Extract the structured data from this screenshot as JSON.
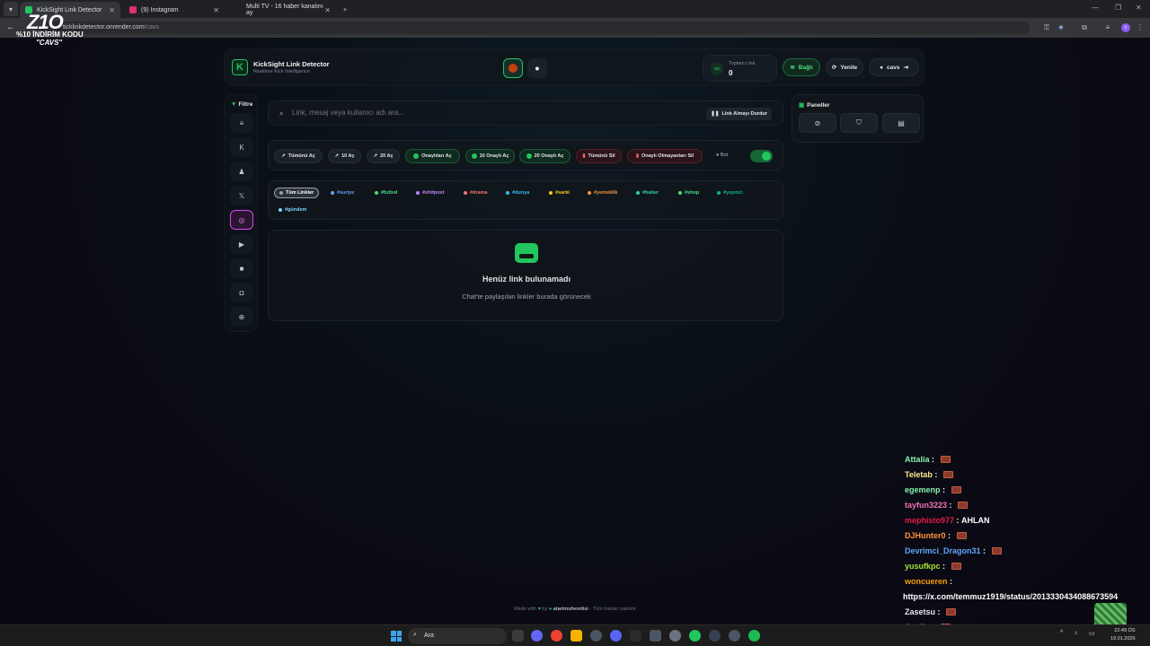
{
  "browser": {
    "tabs": [
      {
        "title": "KickSight Link Detector",
        "active": true
      },
      {
        "title": "(9) Instagram",
        "active": false
      },
      {
        "title": "Multi TV - 16 haber kanalını ay",
        "active": false
      }
    ],
    "url_host": "ticklinkdetector.onrender.com",
    "url_path": "/cavs"
  },
  "overlay_logo": {
    "big": "Z1O",
    "line1": "%10 İNDİRİM KODU",
    "line2": "\"CAVS\""
  },
  "header": {
    "title": "KickSight Link Detector",
    "subtitle": "Realtime Kick Intelligence",
    "stat_label": "Toplam Link",
    "stat_value": "0",
    "connected_label": "Bağlı",
    "refresh_label": "Yenile",
    "user_label": "cavs"
  },
  "sidebar": {
    "filter_label": "Filtre",
    "items": [
      {
        "name": "all",
        "icon": "≡"
      },
      {
        "name": "kick",
        "icon": "K"
      },
      {
        "name": "user",
        "icon": "♟"
      },
      {
        "name": "x",
        "icon": "𝕏"
      },
      {
        "name": "instagram",
        "icon": "◎"
      },
      {
        "name": "youtube",
        "icon": "▶"
      },
      {
        "name": "video",
        "icon": "■"
      },
      {
        "name": "camera",
        "icon": "◘"
      },
      {
        "name": "web",
        "icon": "⊕"
      }
    ]
  },
  "search": {
    "placeholder": "Link, mesaj veya kullanıcı adı ara...",
    "stop_label": "Link Almayı Durdur"
  },
  "actions": [
    {
      "label": "Tümünü Aç",
      "kind": "plain",
      "icon": "↗"
    },
    {
      "label": "10 Aç",
      "kind": "plain",
      "icon": "↗"
    },
    {
      "label": "20 Aç",
      "kind": "plain",
      "icon": "↗"
    },
    {
      "label": "Onaylıları Aç",
      "kind": "green",
      "icon": "dot"
    },
    {
      "label": "10 Onaylı Aç",
      "kind": "green",
      "icon": "dot"
    },
    {
      "label": "20 Onaylı Aç",
      "kind": "green",
      "icon": "dot"
    },
    {
      "label": "Tümünü Sil",
      "kind": "red",
      "icon": "del"
    },
    {
      "label": "Onaylı Olmayanları Sil",
      "kind": "red",
      "icon": "del"
    }
  ],
  "bot_label": "Bot",
  "bot_enabled": true,
  "tags": [
    {
      "label": "Tüm Linkler",
      "color": "#9ca3af",
      "selected": true
    },
    {
      "label": "#suriye",
      "color": "#60a5fa"
    },
    {
      "label": "#futbol",
      "color": "#4ade80"
    },
    {
      "label": "#shitpost",
      "color": "#c084fc"
    },
    {
      "label": "#drama",
      "color": "#f87171"
    },
    {
      "label": "#dunya",
      "color": "#38bdf8"
    },
    {
      "label": "#sarki",
      "color": "#facc15"
    },
    {
      "label": "#yemeklik",
      "color": "#fb923c"
    },
    {
      "label": "#haber",
      "color": "#34d399"
    },
    {
      "label": "#shop",
      "color": "#4ade80"
    },
    {
      "label": "#yayıncı",
      "color": "#10b981"
    },
    {
      "label": "#gündem",
      "color": "#7dd3fc"
    }
  ],
  "empty": {
    "title": "Henüz link bulunamadı",
    "subtitle": "Chat'te paylaşılan linkler burada görünecek"
  },
  "panels": {
    "title": "Paneller",
    "buttons": [
      {
        "icon": "⊘"
      },
      {
        "icon": "⛉"
      },
      {
        "icon": "▤"
      }
    ]
  },
  "footer": {
    "made_with": "Made with",
    "by": "by",
    "author": "atarimuhendisi",
    "rights": "· Tüm hakları saklıdır"
  },
  "chat": [
    {
      "user": "Attalia",
      "color": "#86efac",
      "text": "",
      "emote": true
    },
    {
      "user": "Teletab",
      "color": "#fde68a",
      "text": "",
      "emote": true
    },
    {
      "user": "egemenp",
      "color": "#86efac",
      "text": "",
      "emote": true
    },
    {
      "user": "tayfun3223",
      "color": "#f472b6",
      "text": "",
      "emote": true
    },
    {
      "user": "mephisto977",
      "color": "#e11d48",
      "text": "AHLAN",
      "emote": false
    },
    {
      "user": "DJHunter0",
      "color": "#fb923c",
      "text": "",
      "emote": true
    },
    {
      "user": "Devrimci_Dragon31",
      "color": "#60a5fa",
      "text": "",
      "emote": true
    },
    {
      "user": "yusufkpc",
      "color": "#a3e635",
      "text": "",
      "emote": true
    },
    {
      "user": "woncueren",
      "color": "#f59e0b",
      "text": "",
      "emote": false
    },
    {
      "user": "",
      "color": "#ffffff",
      "text": "https://x.com/temmuz1919/status/2013330434088673594",
      "emote": false
    },
    {
      "user": "Zasetsu",
      "color": "#e5e7eb",
      "text": "",
      "emote": true
    },
    {
      "user": "Attalia",
      "color": "#86efac",
      "text": "",
      "emote": true
    }
  ],
  "taskbar": {
    "search_label": "Ara",
    "time": "22:49 ÖS",
    "date": "19.01.2026"
  }
}
